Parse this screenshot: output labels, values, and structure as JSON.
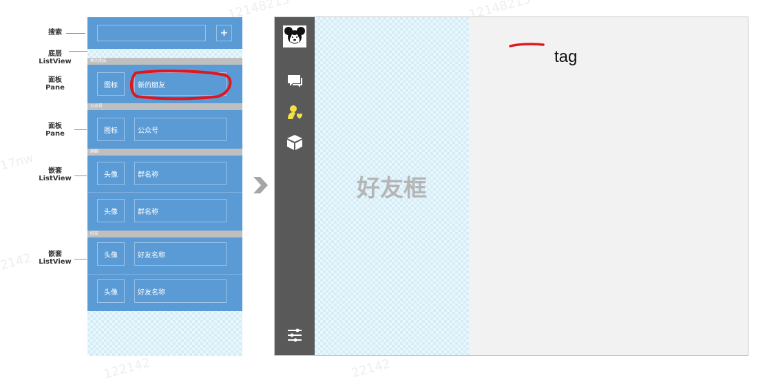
{
  "watermarks": [
    "12148215",
    "12148215",
    "17nw",
    "122142",
    "2142",
    "22142"
  ],
  "left": {
    "labels": {
      "search": "搜索",
      "bottom_layer": [
        "底层",
        "ListView"
      ],
      "pane1": [
        "面板",
        "Pane"
      ],
      "pane2": [
        "面板",
        "Pane"
      ],
      "nested1": [
        "嵌套",
        "ListView"
      ],
      "nested2": [
        "嵌套",
        "ListView"
      ]
    },
    "add_button": "+",
    "sections": [
      {
        "header": "新的朋友",
        "rows": [
          {
            "icon": "图标",
            "name": "新的朋友"
          }
        ]
      },
      {
        "header": "公众号",
        "rows": [
          {
            "icon": "图标",
            "name": "公众号"
          }
        ]
      },
      {
        "header": "群聊",
        "rows": [
          {
            "icon": "头像",
            "name": "群名称"
          },
          {
            "icon": "头像",
            "name": "群名称"
          }
        ]
      },
      {
        "header": "好友",
        "rows": [
          {
            "icon": "头像",
            "name": "好友名称"
          },
          {
            "icon": "头像",
            "name": "好友名称"
          }
        ]
      }
    ]
  },
  "arrow": "›",
  "right": {
    "friend_box_label": "好友框",
    "tag_label": "tag",
    "nav_icons": [
      "mickey-avatar-icon",
      "chat-icon",
      "contact-icon",
      "box-icon",
      "settings-sliders-icon"
    ]
  }
}
